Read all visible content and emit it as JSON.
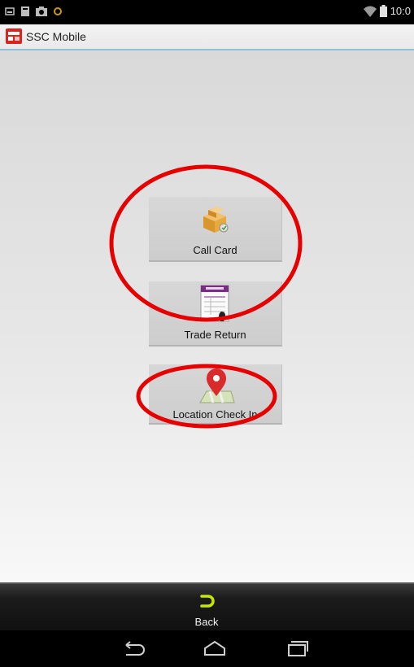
{
  "status_bar": {
    "time": "10:0",
    "icons": [
      "screenshot-icon",
      "storage-icon",
      "camera-icon",
      "notification-dot-icon",
      "wifi-icon",
      "battery-icon"
    ]
  },
  "app": {
    "title": "SSC Mobile",
    "icon": "ssc-app-icon"
  },
  "menu": {
    "items": [
      {
        "label": "Call Card",
        "icon": "boxes-icon"
      },
      {
        "label": "Trade Return",
        "icon": "returns-form-icon"
      },
      {
        "label": "Location Check In",
        "icon": "map-pin-icon"
      }
    ]
  },
  "bottom_bar": {
    "back_label": "Back",
    "back_icon": "back-arrow-icon",
    "accent": "#c6e800"
  },
  "nav_bar": {
    "icons": [
      "nav-back-icon",
      "nav-home-icon",
      "nav-recents-icon"
    ]
  },
  "annotations": {
    "color": "#e60000"
  }
}
